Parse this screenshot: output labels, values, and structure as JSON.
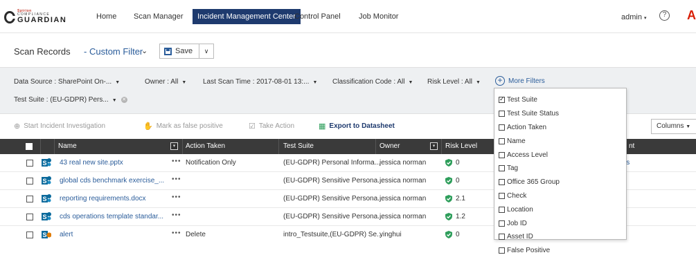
{
  "nav": {
    "logo_small": "Spirion",
    "logo_sub": "COMPLIANCE",
    "logo_main": "GUARDIAN",
    "items": [
      "Home",
      "Scan Manager",
      "Incident Management Center",
      "Control Panel",
      "Job Monitor"
    ],
    "user": "admin",
    "help": "?",
    "brand_letter": "A"
  },
  "title": {
    "label": "Scan Records",
    "separator": "-",
    "filter_name": "Custom Filter",
    "save_label": "Save"
  },
  "filters": {
    "data_source": "Data Source : SharePoint On-...",
    "owner": "Owner : All",
    "last_scan_time": "Last Scan Time : 2017-08-01 13:...",
    "classification": "Classification Code : All",
    "risk_level": "Risk Level : All",
    "test_suite": "Test Suite : (EU-GDPR) Pers...",
    "more_filters": "More Filters"
  },
  "actions": {
    "start_investigation": "Start Incident Investigation",
    "mark_false_positive": "Mark as false positive",
    "take_action": "Take Action",
    "export": "Export to Datasheet",
    "columns": "Columns"
  },
  "table": {
    "headers": {
      "name": "Name",
      "action_taken": "Action Taken",
      "test_suite": "Test Suite",
      "owner": "Owner",
      "risk_level": "Risk Level",
      "last": "nt"
    },
    "rows": [
      {
        "name": "43 real new site.pptx",
        "dots": "•••",
        "action": "Notification Only",
        "suite": "(EU-GDPR) Personal Informa...",
        "owner": "jessica norman",
        "risk": "0",
        "incidents": "ncidents"
      },
      {
        "name": "global cds benchmark exercise_...",
        "dots": "•••",
        "action": "",
        "suite": "(EU-GDPR) Sensitive Persona...",
        "owner": "jessica norman",
        "risk": "0",
        "incidents": ""
      },
      {
        "name": "reporting requirements.docx",
        "dots": "•••",
        "action": "",
        "suite": "(EU-GDPR) Sensitive Persona...",
        "owner": "jessica norman",
        "risk": "2.1",
        "incidents": ""
      },
      {
        "name": "cds operations template standar...",
        "dots": "•••",
        "action": "",
        "suite": "(EU-GDPR) Sensitive Persona...",
        "owner": "jessica norman",
        "risk": "1.2",
        "incidents": ""
      },
      {
        "name": "alert",
        "dots": "•••",
        "action": "Delete",
        "suite": "intro_Testsuite,(EU-GDPR) Se...",
        "owner": "yinghui",
        "risk": "0",
        "incidents": ""
      }
    ]
  },
  "more_filters_menu": {
    "items": [
      {
        "label": "Test Suite",
        "checked": true
      },
      {
        "label": "Test Suite Status",
        "checked": false
      },
      {
        "label": "Action Taken",
        "checked": false
      },
      {
        "label": "Name",
        "checked": false
      },
      {
        "label": "Access Level",
        "checked": false
      },
      {
        "label": "Tag",
        "checked": false
      },
      {
        "label": "Office 365 Group",
        "checked": false
      },
      {
        "label": "Check",
        "checked": false
      },
      {
        "label": "Location",
        "checked": false
      },
      {
        "label": "Job ID",
        "checked": false
      },
      {
        "label": "Asset ID",
        "checked": false
      },
      {
        "label": "False Positive",
        "checked": false
      }
    ]
  },
  "colors": {
    "accent": "#1e3a6e",
    "link": "#2a5c9a",
    "shield_green": "#2e9e5b",
    "header_dark": "#3a3a3a"
  }
}
